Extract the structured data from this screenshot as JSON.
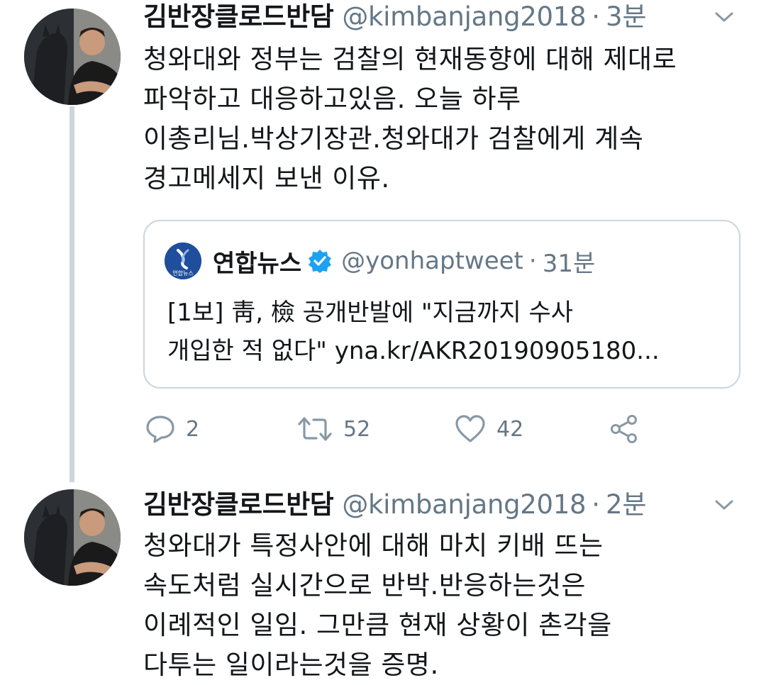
{
  "tweets": [
    {
      "author_name": "김반장클로드반담",
      "handle": "@kimbanjang2018",
      "separator": "·",
      "time": "3분",
      "lines": [
        "청와대와 정부는 검찰의 현재동향에 대해 제대로",
        "파악하고 대응하고있음. 오늘 하루",
        "이총리님.박상기장관.청와대가 검찰에게 계속",
        "경고메세지 보낸 이유."
      ],
      "quoted": {
        "logo_text": "연합뉴스",
        "author_name": "연합뉴스",
        "handle": "@yonhaptweet",
        "separator": "·",
        "time": "31분",
        "lines": [
          "[1보] 靑, 檢 공개반발에 \"지금까지 수사",
          "개입한 적 없다\" yna.kr/AKR20190905180..."
        ]
      },
      "actions": {
        "reply_count": "2",
        "retweet_count": "52",
        "like_count": "42"
      }
    },
    {
      "author_name": "김반장클로드반담",
      "handle": "@kimbanjang2018",
      "separator": "·",
      "time": "2분",
      "lines": [
        "청와대가 특정사안에 대해 마치 키배 뜨는",
        "속도처럼 실시간으로 반박.반응하는것은",
        "이례적인 일임. 그만큼 현재 상황이 촌각을",
        "다투는 일이라는것을 증명."
      ]
    }
  ],
  "colors": {
    "text": "#14171a",
    "secondary": "#657786",
    "border": "#ccd6dd",
    "verified": "#1da1f2",
    "yonhap": "#1f4f9c"
  },
  "icons": [
    "chevron-down-icon",
    "reply-icon",
    "retweet-icon",
    "like-icon",
    "share-icon",
    "verified-badge-icon"
  ]
}
